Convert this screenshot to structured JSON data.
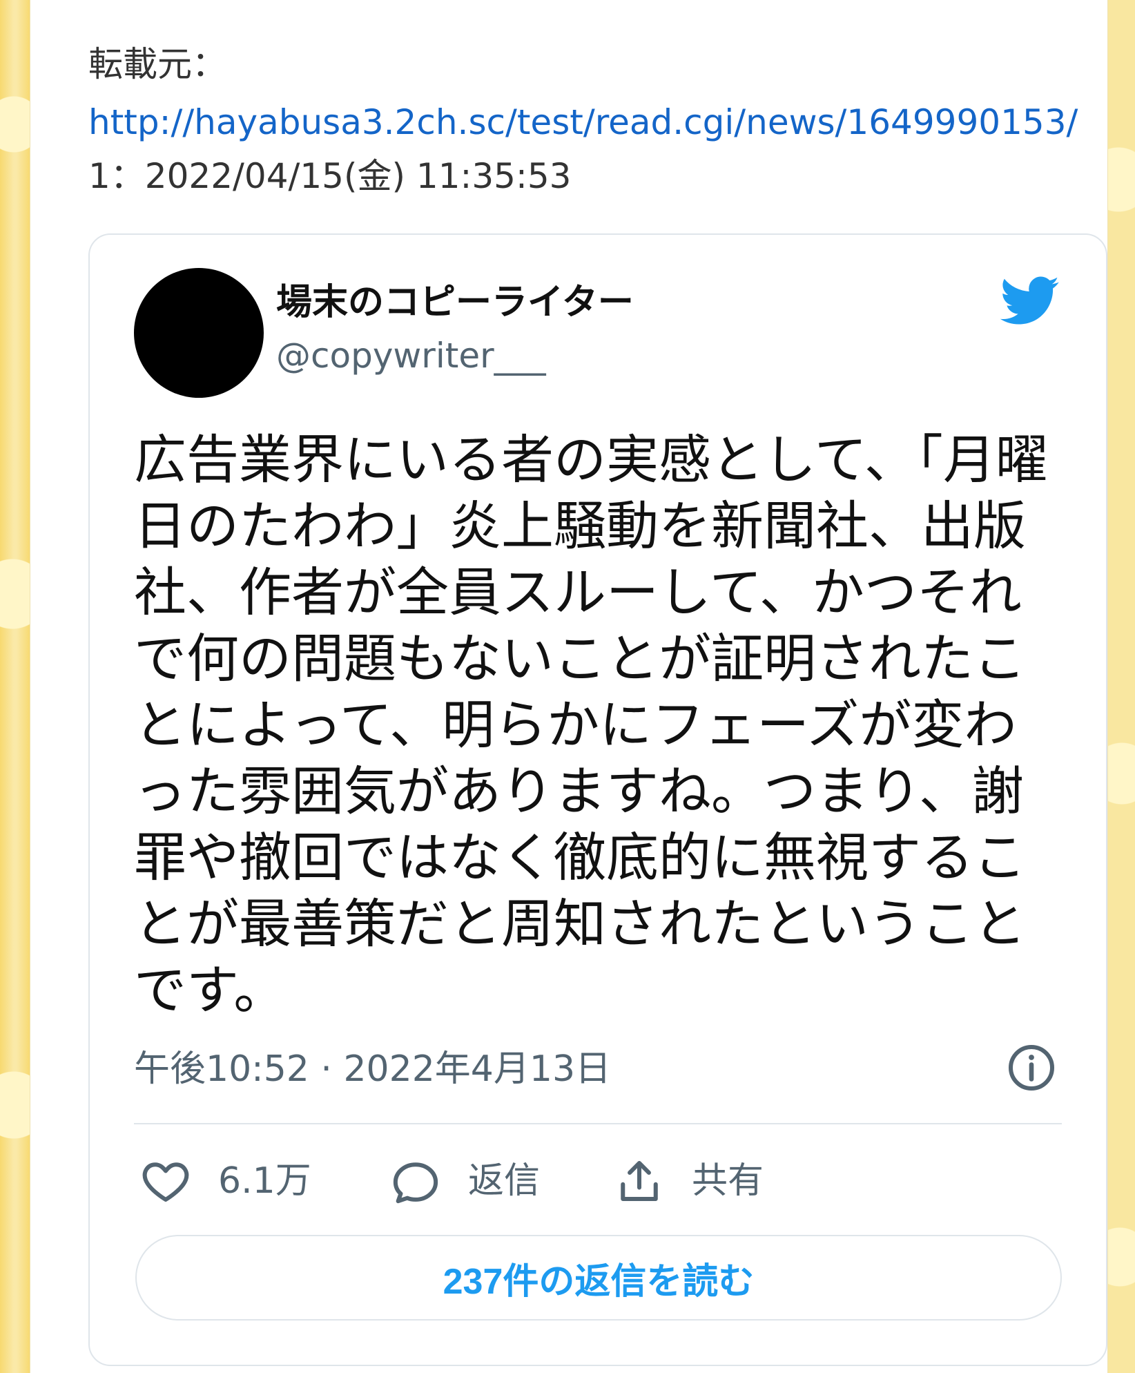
{
  "page": {
    "source_label": "転載元：",
    "source_url": "http://hayabusa3.2ch.sc/test/read.cgi/news/1649990153/",
    "post_meta": "1：2022/04/15(金) 11:35:53"
  },
  "tweet": {
    "display_name": "場末のコピーライター",
    "handle": "@copywriter___",
    "text": "広告業界にいる者の実感として、「月曜日のたわわ」炎上騒動を新聞社、出版社、作者が全員スルーして、かつそれで何の問題もないことが証明されたことによって、明らかにフェーズが変わった雰囲気がありますね。つまり、謝罪や撤回ではなく徹底的に無視することが最善策だと周知されたということです。",
    "timestamp": "午後10:52 · 2022年4月13日",
    "likes": "6.1万",
    "reply_label": "返信",
    "share_label": "共有",
    "read_replies": "237件の返信を読む"
  },
  "icons": {
    "brand": "twitter-bird-icon",
    "info": "info-icon",
    "like": "heart-icon",
    "reply": "reply-bubble-icon",
    "share": "share-upload-icon"
  },
  "colors": {
    "background": "#f9e7a0",
    "link": "#1465c8",
    "twitter_blue": "#1d9bf0",
    "muted_text": "#536471"
  }
}
